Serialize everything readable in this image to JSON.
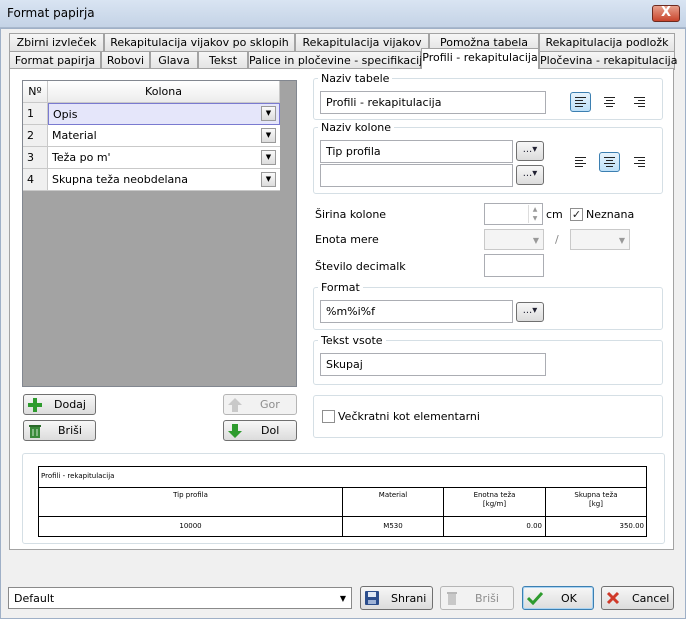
{
  "window": {
    "title": "Format papirja",
    "close_label": "X"
  },
  "tabs_row1": [
    "Zbirni izvleček",
    "Rekapitulacija vijakov po sklopih",
    "Rekapitulacija vijakov",
    "Pomožna tabela",
    "Rekapitulacija podložk"
  ],
  "tabs_row2": [
    "Format papirja",
    "Robovi",
    "Glava",
    "Tekst",
    "Palice in pločevine - specifikacija",
    "Profili - rekapitulacija",
    "Pločevina - rekapitulacija"
  ],
  "active_tab": "Profili - rekapitulacija",
  "grid": {
    "header_no": "Nº",
    "header_col": "Kolona",
    "rows": [
      {
        "no": "1",
        "value": "Opis",
        "selected": true
      },
      {
        "no": "2",
        "value": "Material",
        "selected": false
      },
      {
        "no": "3",
        "value": "Teža po m'",
        "selected": false
      },
      {
        "no": "4",
        "value": "Skupna teža neobdelana",
        "selected": false
      }
    ]
  },
  "buttons": {
    "add": "Dodaj",
    "delete_row": "Briši",
    "up": "Gor",
    "down": "Dol"
  },
  "table_name": {
    "label": "Naziv tabele",
    "value": "Profili - rekapitulacija",
    "alignment": "left"
  },
  "column_name": {
    "label": "Naziv kolone",
    "value1": "Tip profila",
    "value2": "",
    "alignment": "center"
  },
  "ellipsis": "...",
  "col_width": {
    "label": "Širina kolone",
    "value": "",
    "unit": "cm",
    "unknown_label": "Neznana",
    "unknown_checked": true
  },
  "unit_measure": {
    "label": "Enota mere",
    "value1": "",
    "separator": "/",
    "value2": ""
  },
  "decimals": {
    "label": "Število decimalk",
    "value": ""
  },
  "format": {
    "label": "Format",
    "value": "%m%i%f"
  },
  "sum_text": {
    "label": "Tekst vsote",
    "value": "Skupaj"
  },
  "multiple_angle": {
    "label": "Večkratni kot elementarni",
    "checked": false
  },
  "preview": {
    "title": "Profili - rekapitulacija",
    "headers": [
      "Tip profila",
      "Material",
      "Enotna teža\n[kg/m]",
      "Skupna teža\n[kg]"
    ],
    "row": [
      "10000",
      "M530",
      "0.00",
      "350.00"
    ]
  },
  "footer": {
    "preset": "Default",
    "save": "Shrani",
    "delete": "Briši",
    "ok": "OK",
    "cancel": "Cancel"
  },
  "colors": {
    "accent": "#3c7fb1",
    "window_frame": "#c4d3e6",
    "close_red": "#c8442c",
    "ok_green": "#2e9b2e",
    "cancel_red": "#d03a2a"
  }
}
